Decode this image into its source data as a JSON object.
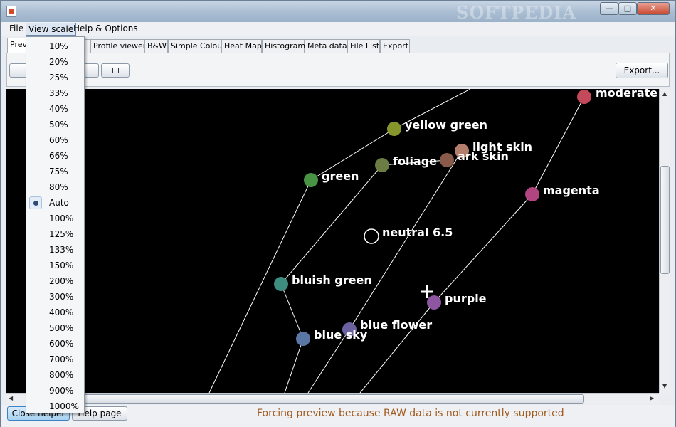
{
  "window": {
    "watermark": "SOFTPEDIA",
    "min": "—",
    "max": "□",
    "close": "✕"
  },
  "menu": {
    "file": "File",
    "view_scale": "View scale",
    "help": "Help & Options"
  },
  "tabs": [
    "Prev",
    "Profile viewer",
    "B&W",
    "Simple Colour",
    "Heat Map",
    "Histogram",
    "Meta data",
    "File List",
    "Export"
  ],
  "toolbar": {
    "export_label": "Export..."
  },
  "view_scale_options": [
    "10%",
    "20%",
    "25%",
    "33%",
    "40%",
    "50%",
    "60%",
    "66%",
    "75%",
    "80%",
    "Auto",
    "100%",
    "125%",
    "133%",
    "150%",
    "200%",
    "300%",
    "400%",
    "500%",
    "600%",
    "700%",
    "800%",
    "900%",
    "1000%"
  ],
  "selected_scale": "Auto",
  "plot": {
    "points": [
      {
        "label": "moderate",
        "color": "#c4495a"
      },
      {
        "label": "yellow green",
        "color": "#86962a"
      },
      {
        "label": "light skin",
        "color": "#b47e6c"
      },
      {
        "label": "ark skin",
        "color": "#8a5a4a"
      },
      {
        "label": "foliage",
        "color": "#6b7d42"
      },
      {
        "label": "green",
        "color": "#4a9344"
      },
      {
        "label": "magenta",
        "color": "#b04580"
      },
      {
        "label": "neutral 6.5",
        "color": "#000000"
      },
      {
        "label": "bluish green",
        "color": "#3e8e80"
      },
      {
        "label": "purple",
        "color": "#8e55a0"
      },
      {
        "label": "blue flower",
        "color": "#6a62a0"
      },
      {
        "label": "blue sky",
        "color": "#5a76a4"
      }
    ]
  },
  "bottom": {
    "close_helper": "Close helper",
    "help_page": "Help page",
    "status": "Forcing preview because RAW data is not currently supported"
  }
}
